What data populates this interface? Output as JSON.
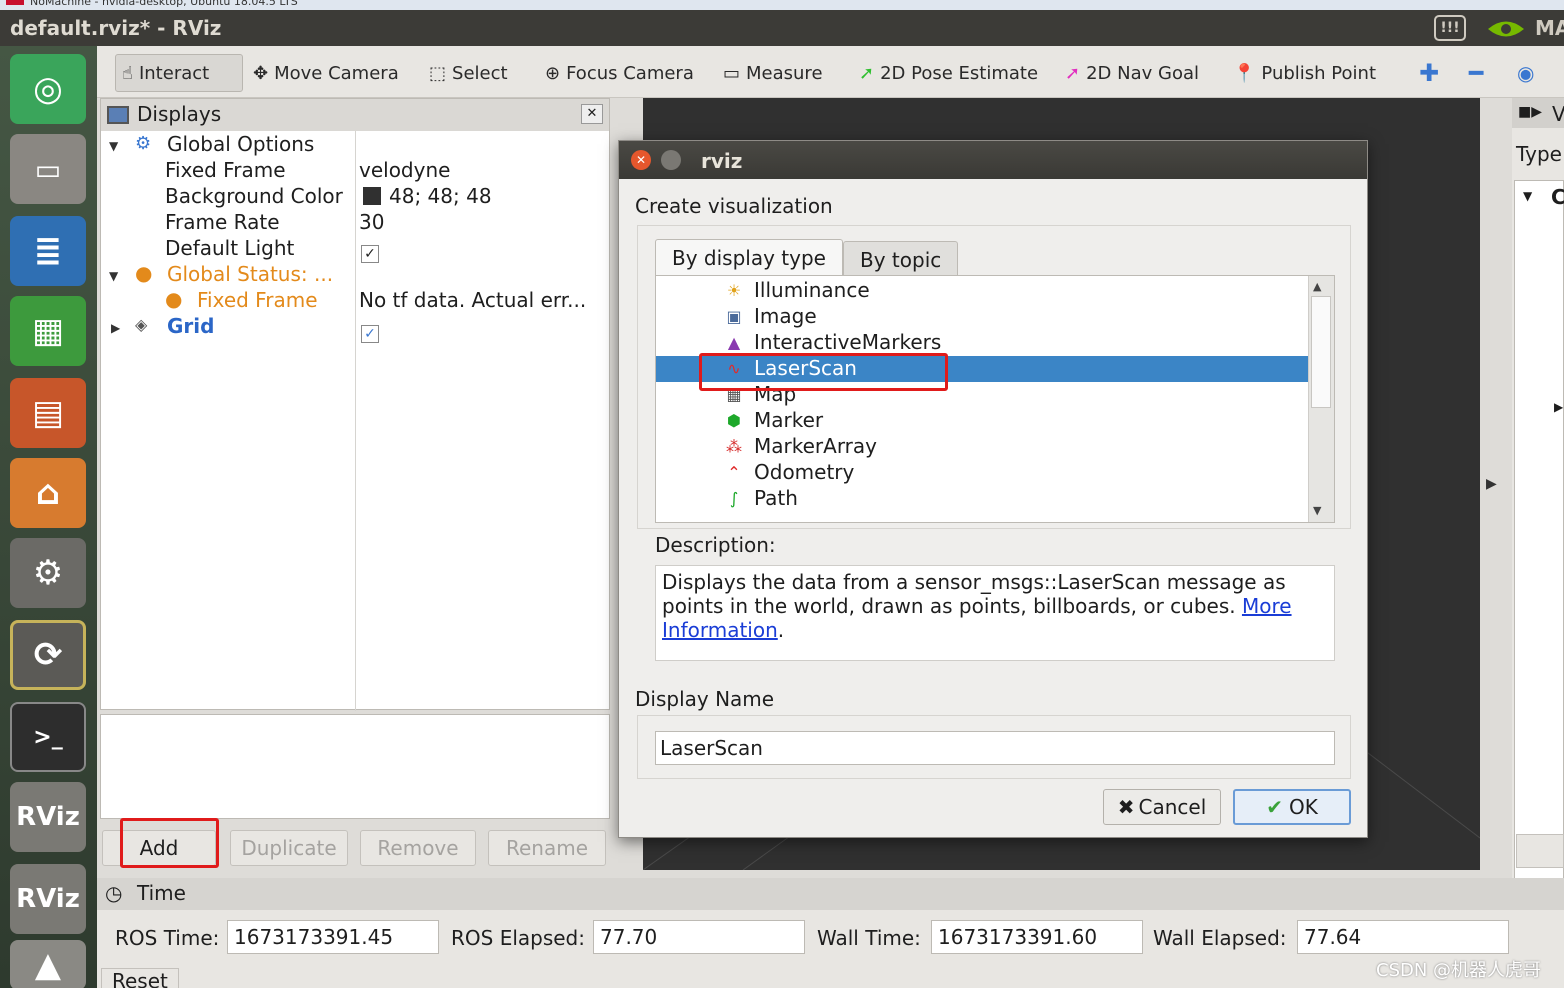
{
  "outer": {
    "label": "NoMachine - nvidia-desktop, Ubuntu 18.04.5 LTS"
  },
  "window": {
    "title": "default.rviz* - RViz",
    "ma": "MA"
  },
  "launcher": {
    "items": [
      "ubuntu-logo",
      "files",
      "writer",
      "calc",
      "impress",
      "software-center",
      "system-settings",
      "software-updater",
      "terminal",
      "rviz",
      "rviz"
    ],
    "rviz1": "RViz",
    "rviz2": "RViz"
  },
  "toolbar": {
    "interact": "Interact",
    "move_camera": "Move Camera",
    "select": "Select",
    "focus_camera": "Focus Camera",
    "measure": "Measure",
    "pose_estimate": "2D Pose Estimate",
    "nav_goal": "2D Nav Goal",
    "publish_point": "Publish Point"
  },
  "displays": {
    "title": "Displays",
    "global_options": "Global Options",
    "fixed_frame_label": "Fixed Frame",
    "fixed_frame_value": "velodyne",
    "bg_color_label": "Background Color",
    "bg_color_value": "48; 48; 48",
    "frame_rate_label": "Frame Rate",
    "frame_rate_value": "30",
    "default_light_label": "Default Light",
    "default_light_check": "✓",
    "global_status": "Global Status: ...",
    "status_fixed_frame": "Fixed Frame",
    "status_fixed_frame_value": "No tf data.  Actual err...",
    "grid": "Grid",
    "grid_check": "✓"
  },
  "buttons": {
    "add": "Add",
    "duplicate": "Duplicate",
    "remove": "Remove",
    "rename": "Rename"
  },
  "right_panel": {
    "type_label": "Type",
    "c_label": "C",
    "v_label": "V"
  },
  "time": {
    "title": "Time",
    "ros_time_label": "ROS Time:",
    "ros_time": "1673173391.45",
    "ros_elapsed_label": "ROS Elapsed:",
    "ros_elapsed": "77.70",
    "wall_time_label": "Wall Time:",
    "wall_time": "1673173391.60",
    "wall_elapsed_label": "Wall Elapsed:",
    "wall_elapsed": "77.64",
    "reset": "Reset"
  },
  "dialog": {
    "title": "rviz",
    "create_label": "Create visualization",
    "tab_display_type": "By display type",
    "tab_topic": "By topic",
    "items": [
      "Illuminance",
      "Image",
      "InteractiveMarkers",
      "LaserScan",
      "Map",
      "Marker",
      "MarkerArray",
      "Odometry",
      "Path"
    ],
    "selected": "LaserScan",
    "description_label": "Description:",
    "description_text": "Displays the data from a sensor_msgs::LaserScan message as points in the world, drawn as points, billboards, or cubes. ",
    "description_link": "More Information",
    "display_name_label": "Display Name",
    "display_name_value": "LaserScan",
    "cancel": "Cancel",
    "ok": "OK"
  },
  "watermark": "CSDN @机器人虎哥",
  "colors": {
    "selection": "#3b85c6",
    "highlight_box": "#e01b1b",
    "warning": "#e38a1b"
  }
}
